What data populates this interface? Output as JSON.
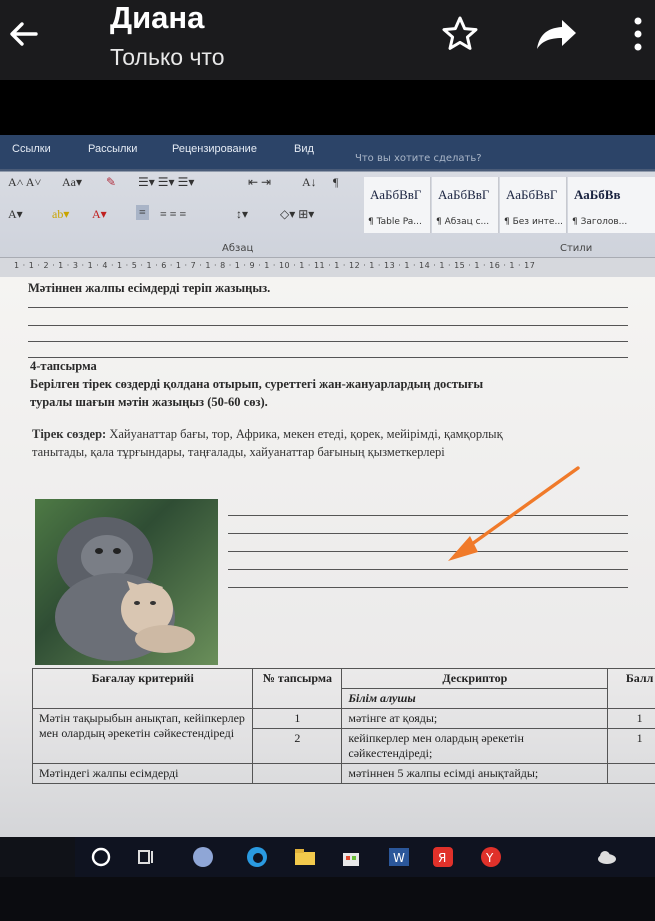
{
  "header": {
    "title": "Диана",
    "subtitle": "Только что"
  },
  "word": {
    "tabs": [
      "Ссылки",
      "Рассылки",
      "Рецензирование",
      "Вид"
    ],
    "tell_me": "Что вы хотите сделать?",
    "group_paragraph": "Абзац",
    "group_styles": "Стили",
    "styles": [
      {
        "sample": "АаБбВвГ",
        "name": "¶ Table Pa..."
      },
      {
        "sample": "АаБбВвГ",
        "name": "¶ Абзац с..."
      },
      {
        "sample": "АаБбВвГ",
        "name": "¶ Без инте..."
      },
      {
        "sample": "АаБбВв",
        "name": "¶ Заголов..."
      }
    ],
    "ruler": "1 · 1 · 2 · 1 · 3 · 1 · 4 · 1 · 5 · 1 · 6 · 1 · 7 · 1 · 8 · 1 · 9 · 1 · 10 · 1 · 11 · 1 · 12 · 1 · 13 · 1 · 14 · 1 · 15 · 1 · 16 · 1 · 17"
  },
  "doc": {
    "line0": "Мәтіннен жалпы есімдерді теріп жазыңыз.",
    "task_title": "4-тапсырма",
    "task_line1": "Берілген тірек сөздерді қолдана отырып, суреттегі жан-жануарлардың достығы",
    "task_line2": "туралы шағын мәтін жазыңыз (50-60 сөз).",
    "support_label": "Тірек сөздер:",
    "support_line1": " Хайуанаттар бағы, тор, Африка, мекен етеді, қорек, мейірімді, қамқорлық",
    "support_line2": "танытады, қала тұрғындары, таңғалады, хайуанаттар бағының қызметкерлері"
  },
  "table": {
    "headers": {
      "criteria": "Бағалау критерийі",
      "task_no": "№ тапсырма",
      "descriptor": "Дескриптор",
      "score": "Балл"
    },
    "subheader": "Білім алушы",
    "rows": [
      {
        "criteria": "Мәтін тақырыбын анықтап, кейіпкерлер мен олардың әрекетін сәйкестендіреді",
        "no1": "1",
        "no2": "2",
        "d1": "мәтінге ат қояды;",
        "d2": "кейіпкерлер мен олардың әрекетін сәйкестендіреді;",
        "s1": "1",
        "s2": "1"
      },
      {
        "criteria": "Мәтіндегі жалпы есімдерді",
        "d1": "мәтіннен 5 жалпы есімді анықтайды;"
      }
    ]
  },
  "colors": {
    "topbar": "#1b1b1d",
    "arrow": "#f07a2a"
  }
}
